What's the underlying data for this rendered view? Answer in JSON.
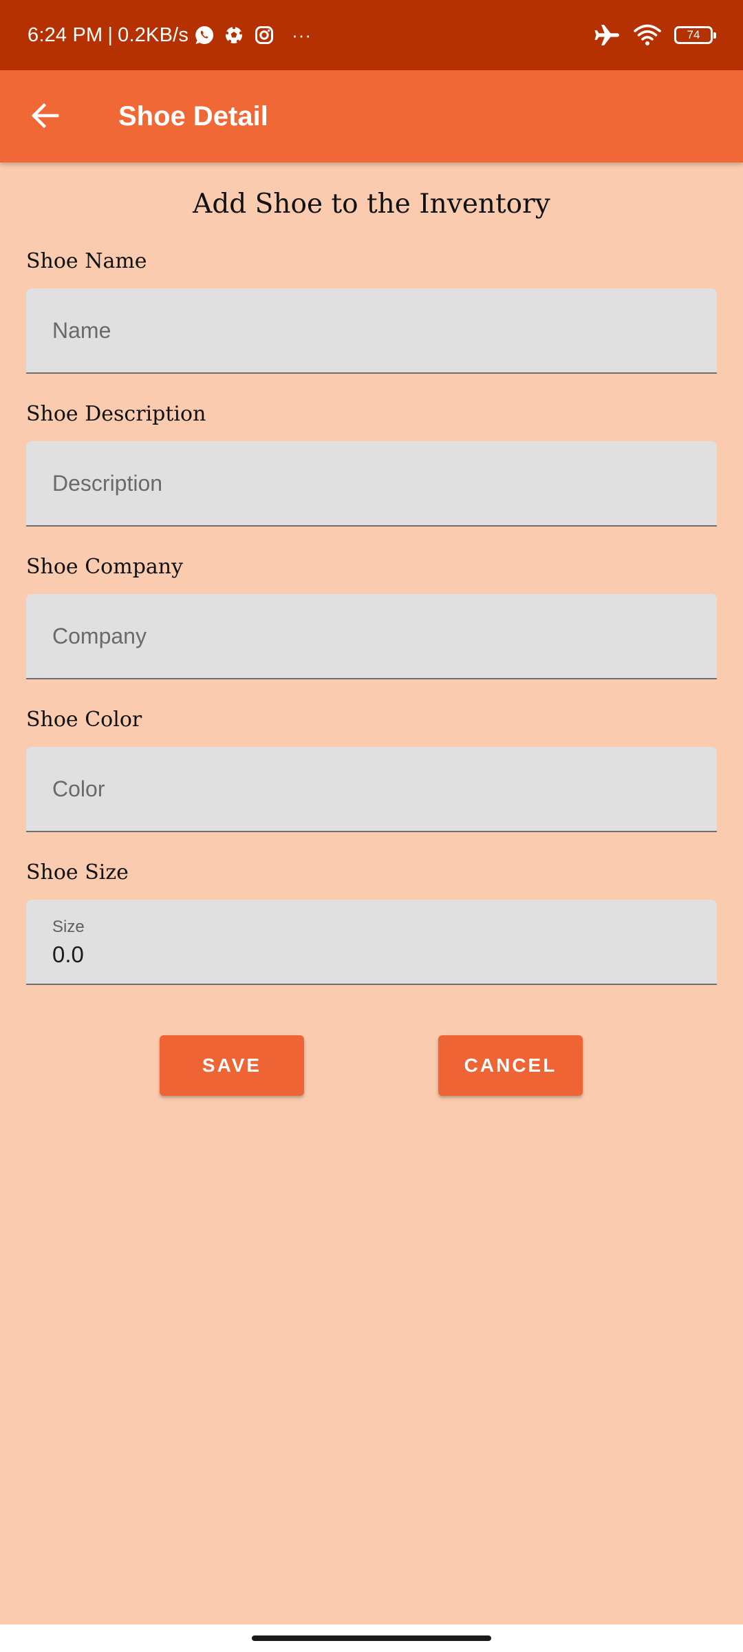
{
  "status_bar": {
    "time": "6:24 PM",
    "separator": "|",
    "speed": "0.2KB/s",
    "more": "···",
    "battery_level": "74",
    "notification_icons": [
      "whatsapp-icon",
      "football-icon",
      "instagram-icon"
    ],
    "system_icons": [
      "airplane-mode-icon",
      "wifi-icon",
      "battery-icon"
    ]
  },
  "app_bar": {
    "title": "Shoe Detail",
    "back_icon": "arrow-back-icon"
  },
  "form": {
    "title": "Add Shoe to the Inventory",
    "name_label": "Shoe Name",
    "name_placeholder": "Name",
    "description_label": "Shoe Description",
    "description_placeholder": "Description",
    "company_label": "Shoe Company",
    "company_placeholder": "Company",
    "color_label": "Shoe Color",
    "color_placeholder": "Color",
    "size_label": "Shoe Size",
    "size_hint": "Size",
    "size_value": "0.0"
  },
  "buttons": {
    "save": "SAVE",
    "cancel": "CANCEL"
  },
  "colors": {
    "status_bar": "#b53102",
    "app_bar": "#f16837",
    "background": "#facbae",
    "field": "#e0e0e0",
    "button": "#ef6435"
  }
}
